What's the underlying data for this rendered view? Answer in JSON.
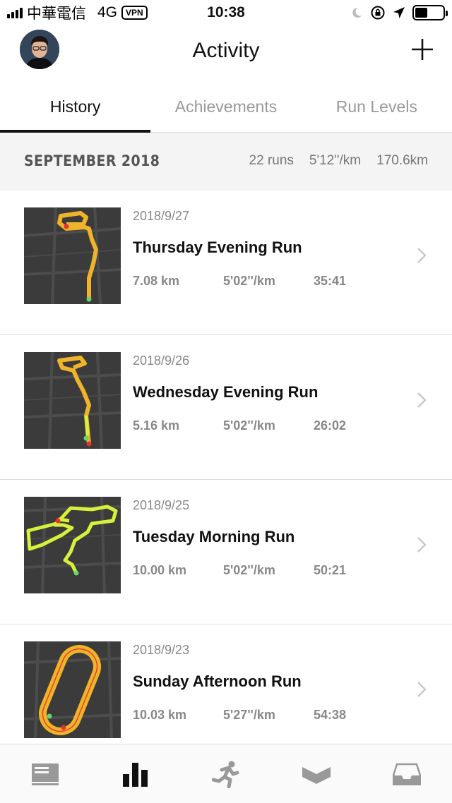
{
  "status_bar": {
    "carrier": "中華電信",
    "network": "4G",
    "vpn": "VPN",
    "time": "10:38"
  },
  "header": {
    "title": "Activity"
  },
  "tabs": [
    {
      "label": "History",
      "active": true
    },
    {
      "label": "Achievements",
      "active": false
    },
    {
      "label": "Run Levels",
      "active": false
    }
  ],
  "summary": {
    "month": "SEPTEMBER 2018",
    "runs": "22 runs",
    "pace": "5'12''/km",
    "distance": "170.6km"
  },
  "runs": [
    {
      "date": "2018/9/27",
      "name": "Thursday Evening Run",
      "distance": "7.08 km",
      "pace": "5'02''/km",
      "duration": "35:41"
    },
    {
      "date": "2018/9/26",
      "name": "Wednesday Evening Run",
      "distance": "5.16 km",
      "pace": "5'02''/km",
      "duration": "26:02"
    },
    {
      "date": "2018/9/25",
      "name": "Tuesday Morning Run",
      "distance": "10.00 km",
      "pace": "5'02''/km",
      "duration": "50:21"
    },
    {
      "date": "2018/9/23",
      "name": "Sunday Afternoon Run",
      "distance": "10.03 km",
      "pace": "5'27''/km",
      "duration": "54:38"
    }
  ],
  "bottom_nav": [
    {
      "icon": "feed-icon",
      "active": false
    },
    {
      "icon": "activity-chart-icon",
      "active": true
    },
    {
      "icon": "runner-icon",
      "active": false
    },
    {
      "icon": "coach-icon",
      "active": false
    },
    {
      "icon": "inbox-icon",
      "active": false
    }
  ]
}
